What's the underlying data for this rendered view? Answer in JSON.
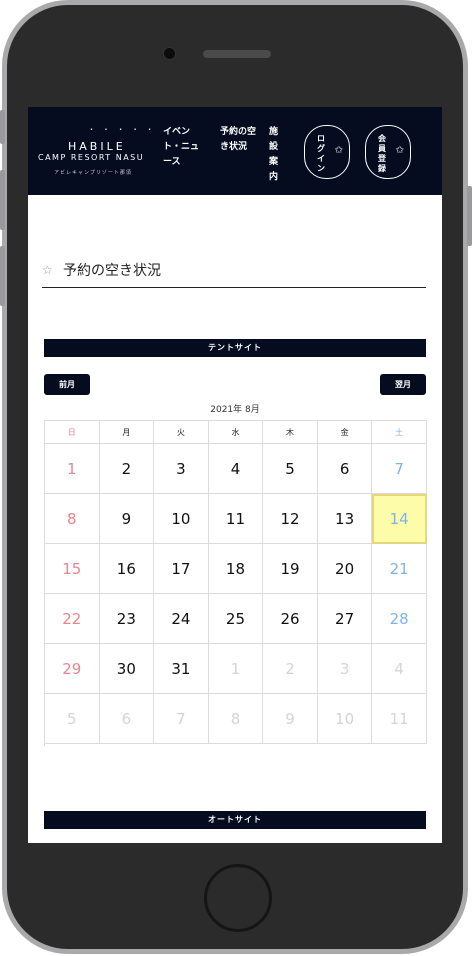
{
  "header": {
    "logo_dots": "• • • • •",
    "logo_name": "HABILE",
    "logo_sub": "CAMP RESORT NASU",
    "logo_jp": "アビレキャンプリゾート那須",
    "nav": [
      "イベント・ニュース",
      "予約の空き状況",
      "施設案内"
    ],
    "login": "ログイン",
    "register": "会員登録",
    "star": "✩"
  },
  "section_title": "予約の空き状況",
  "section_star": "☆",
  "tent_site": "テントサイト",
  "auto_site": "オートサイト",
  "prev_month": "前月",
  "next_month": "翌月",
  "month_label": "2021年 8月",
  "weekdays": [
    "日",
    "月",
    "火",
    "水",
    "木",
    "金",
    "土"
  ],
  "weeks": [
    [
      {
        "d": "1"
      },
      {
        "d": "2"
      },
      {
        "d": "3"
      },
      {
        "d": "4"
      },
      {
        "d": "5"
      },
      {
        "d": "6"
      },
      {
        "d": "7"
      }
    ],
    [
      {
        "d": "8"
      },
      {
        "d": "9"
      },
      {
        "d": "10"
      },
      {
        "d": "11"
      },
      {
        "d": "12"
      },
      {
        "d": "13"
      },
      {
        "d": "14",
        "today": true
      }
    ],
    [
      {
        "d": "15"
      },
      {
        "d": "16"
      },
      {
        "d": "17"
      },
      {
        "d": "18"
      },
      {
        "d": "19"
      },
      {
        "d": "20"
      },
      {
        "d": "21"
      }
    ],
    [
      {
        "d": "22"
      },
      {
        "d": "23"
      },
      {
        "d": "24"
      },
      {
        "d": "25"
      },
      {
        "d": "26"
      },
      {
        "d": "27"
      },
      {
        "d": "28"
      }
    ],
    [
      {
        "d": "29"
      },
      {
        "d": "30"
      },
      {
        "d": "31"
      },
      {
        "d": "1",
        "other": true
      },
      {
        "d": "2",
        "other": true
      },
      {
        "d": "3",
        "other": true
      },
      {
        "d": "4",
        "other": true
      }
    ],
    [
      {
        "d": "5",
        "other": true
      },
      {
        "d": "6",
        "other": true
      },
      {
        "d": "7",
        "other": true
      },
      {
        "d": "8",
        "other": true
      },
      {
        "d": "9",
        "other": true
      },
      {
        "d": "10",
        "other": true
      },
      {
        "d": "11",
        "other": true
      }
    ]
  ],
  "colors": {
    "navy": "#050c1f",
    "sunday": "#e8868c",
    "saturday": "#7fb2ea",
    "today_bg": "#fdfda9"
  }
}
